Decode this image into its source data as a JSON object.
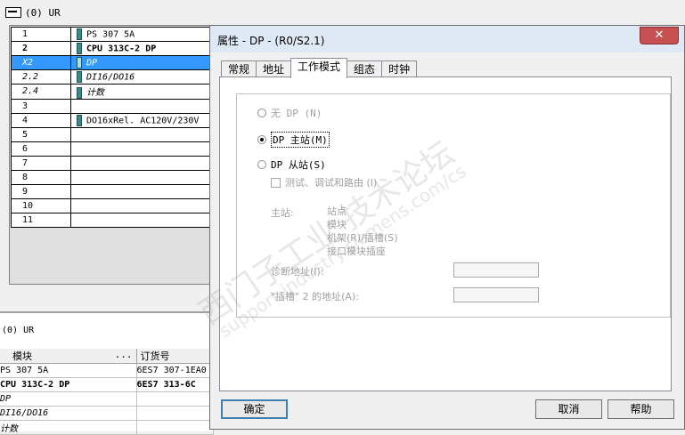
{
  "rack": {
    "header_label": "(0) UR",
    "rows": [
      {
        "slot": "1",
        "module": "PS 307 5A",
        "icon": true,
        "style": ""
      },
      {
        "slot": "2",
        "module": "CPU 313C-2 DP",
        "icon": true,
        "style": "bold"
      },
      {
        "slot": "X2",
        "module": "DP",
        "icon": true,
        "style": "ital sel"
      },
      {
        "slot": "2.2",
        "module": "DI16/DO16",
        "icon": true,
        "style": "ital"
      },
      {
        "slot": "2.4",
        "module": "计数",
        "icon": true,
        "style": "ital"
      },
      {
        "slot": "3",
        "module": "",
        "icon": false,
        "style": ""
      },
      {
        "slot": "4",
        "module": "DO16xRel. AC120V/230V",
        "icon": true,
        "style": ""
      },
      {
        "slot": "5",
        "module": "",
        "icon": false,
        "style": ""
      },
      {
        "slot": "6",
        "module": "",
        "icon": false,
        "style": ""
      },
      {
        "slot": "7",
        "module": "",
        "icon": false,
        "style": ""
      },
      {
        "slot": "8",
        "module": "",
        "icon": false,
        "style": ""
      },
      {
        "slot": "9",
        "module": "",
        "icon": false,
        "style": ""
      },
      {
        "slot": "10",
        "module": "",
        "icon": false,
        "style": ""
      },
      {
        "slot": "11",
        "module": "",
        "icon": false,
        "style": ""
      }
    ]
  },
  "detail": {
    "title": "(0)   UR",
    "col_module": "模块",
    "col_module_dots": "...",
    "col_order": "订货号",
    "rows": [
      {
        "module": "PS 307 5A",
        "order": "6ES7 307-1EA0",
        "style": ""
      },
      {
        "module": "CPU 313C-2 DP",
        "order": "6ES7 313-6C",
        "style": "bold"
      },
      {
        "module": "DP",
        "order": "",
        "style": "ital"
      },
      {
        "module": "DI16/DO16",
        "order": "",
        "style": "ital"
      },
      {
        "module": "计数",
        "order": "",
        "style": "ital"
      }
    ]
  },
  "dialog": {
    "title": "属性 - DP - (R0/S2.1)",
    "close_glyph": "✕",
    "tabs": [
      "常规",
      "地址",
      "工作模式",
      "组态",
      "时钟"
    ],
    "active_tab": "工作模式",
    "radio_none": "无 DP (N)",
    "radio_master": "DP 主站(M)",
    "radio_slave": "DP 从站(S)",
    "checkbox_test": "测试、调试和路由 (I)",
    "master_label": "主站:",
    "master_items": [
      "站点",
      "模块",
      "机架(R)/插槽(S)",
      "接口模块插座"
    ],
    "diag_address_label": "诊断地址(I):",
    "slot2_address_label": "\"插槽\" 2 的地址(A):",
    "ok": "确定",
    "cancel": "取消",
    "help": "帮助"
  },
  "watermark": {
    "line1": "西门子工业 技术论坛",
    "line2": "support.industry.siemens.com/cs"
  }
}
